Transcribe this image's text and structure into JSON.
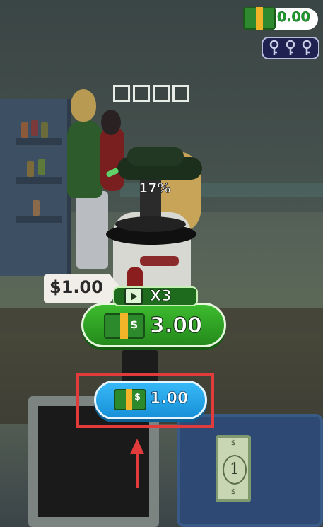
{
  "hud": {
    "money_value": "0.00",
    "keys_count": 3
  },
  "item": {
    "progress_text": "17%",
    "progress_value": 17,
    "slots_count": 4
  },
  "scene": {
    "price_tag": "$1.00",
    "bill_number": "1",
    "bill_symbol": "$"
  },
  "offers": {
    "bonus_multiplier": "X3",
    "bonus_amount": "3.00",
    "collect_amount": "1.00",
    "cash_symbol": "$"
  },
  "colors": {
    "bonus_green": "#248a1c",
    "collect_blue": "#1790d8",
    "highlight_red": "#e23b3b",
    "money_green": "#1f9a2f",
    "key_panel": "#1f2250"
  }
}
